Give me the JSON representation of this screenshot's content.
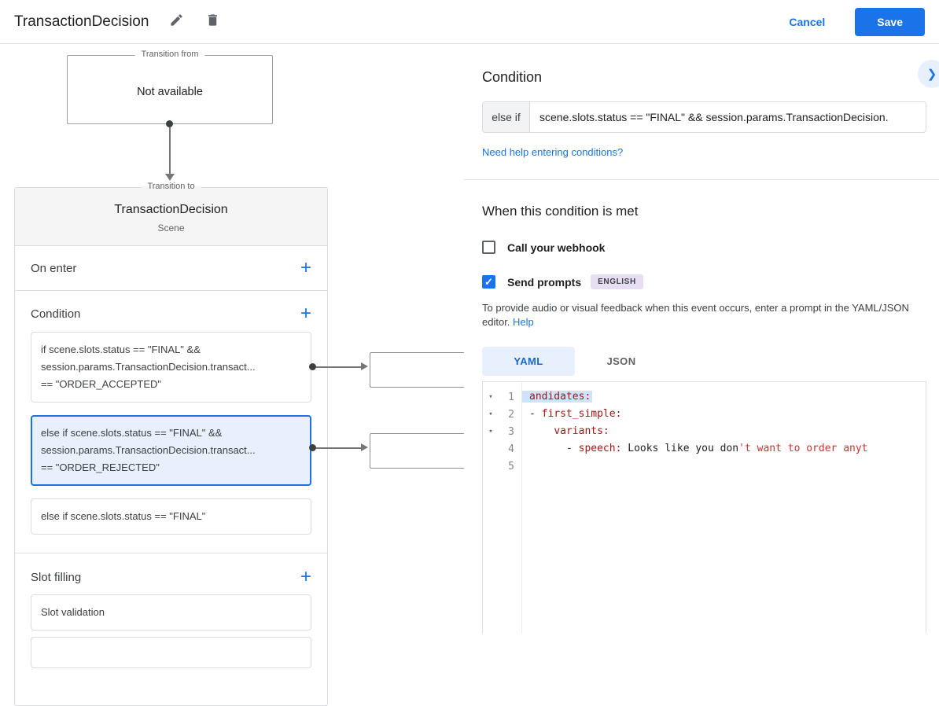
{
  "header": {
    "title": "TransactionDecision",
    "cancel_label": "Cancel",
    "save_label": "Save"
  },
  "icons": {
    "add": "+",
    "chevron_right": "❯",
    "check": "✓",
    "fold": "▾"
  },
  "flow": {
    "transition_from": {
      "label": "Transition from",
      "value": "Not available"
    },
    "transition_to": {
      "label": "Transition to",
      "title": "TransactionDecision",
      "subtitle": "Scene"
    },
    "on_enter_label": "On enter",
    "condition_label": "Condition",
    "conditions": [
      {
        "selected": false,
        "lines": [
          "if scene.slots.status == \"FINAL\" &&",
          "session.params.TransactionDecision.transact...",
          "== \"ORDER_ACCEPTED\""
        ]
      },
      {
        "selected": true,
        "lines": [
          "else if scene.slots.status == \"FINAL\" &&",
          "session.params.TransactionDecision.transact...",
          "== \"ORDER_REJECTED\""
        ]
      },
      {
        "selected": false,
        "lines": [
          "else if scene.slots.status == \"FINAL\""
        ]
      }
    ],
    "slot_filling_label": "Slot filling",
    "slot_items": [
      {
        "label": "Slot validation"
      }
    ]
  },
  "panel": {
    "title": "Condition",
    "condition": {
      "type_label": "else if",
      "value": "scene.slots.status == \"FINAL\" && session.params.TransactionDecision."
    },
    "help_link": "Need help entering conditions?",
    "when_met_title": "When this condition is met",
    "webhook_label": "Call your webhook",
    "send_prompts_label": "Send prompts",
    "language_badge": "ENGLISH",
    "description": "To provide audio or visual feedback when this event occurs, enter a prompt in the YAML/JSON editor.",
    "description_help": "Help",
    "tabs": [
      {
        "label": "YAML"
      },
      {
        "label": "JSON"
      }
    ],
    "editor": {
      "line_numbers": [
        "1",
        "2",
        "3",
        "4",
        "5"
      ],
      "l1": {
        "key": "andidates:"
      },
      "l2": {
        "dash": "- ",
        "key": "first_simple:"
      },
      "l3": {
        "indent": "    ",
        "key": "variants:"
      },
      "l4": {
        "indent": "      ",
        "dash": "- ",
        "key": "speech:",
        "plain": " Looks like you don",
        "string": "'t want to order anyt"
      }
    }
  },
  "colors": {
    "accent": "#1a73e8",
    "selected_condition_bg": "#e8f0fe",
    "yaml_key": "#a31515",
    "yaml_string": "#cd3131",
    "badge_bg": "#e7def3"
  }
}
